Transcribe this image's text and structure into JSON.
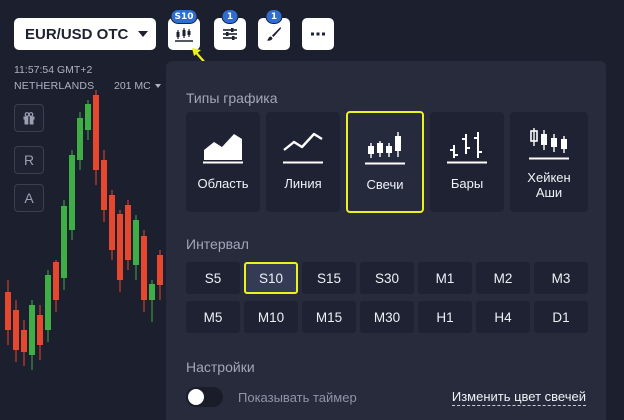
{
  "header": {
    "asset": "EUR/USD OTC",
    "chart_type_badge": "S10",
    "indicators_badge": "1",
    "drawings_badge": "1",
    "more_icon": "ellipsis-icon"
  },
  "meta": {
    "time": "11:57:54 GMT+2",
    "location": "NETHERLANDS",
    "ping": "201 MC"
  },
  "side_tools": {
    "gift_icon": "gift-icon",
    "r_label": "R",
    "a_label": "A"
  },
  "panel": {
    "chart_types_title": "Типы графика",
    "chart_types": [
      {
        "label": "Область",
        "icon": "area-chart-icon"
      },
      {
        "label": "Линия",
        "icon": "line-chart-icon"
      },
      {
        "label": "Свечи",
        "icon": "candles-chart-icon",
        "selected": true
      },
      {
        "label": "Бары",
        "icon": "bars-chart-icon"
      },
      {
        "label": "Хейкен Аши",
        "icon": "heikin-ashi-icon"
      }
    ],
    "interval_title": "Интервал",
    "intervals": [
      "S5",
      "S10",
      "S15",
      "S30",
      "M1",
      "M2",
      "M3",
      "M5",
      "M10",
      "M15",
      "M30",
      "H1",
      "H4",
      "D1"
    ],
    "selected_interval": "S10",
    "settings_title": "Настройки",
    "timer_toggle_label": "Показывать таймер",
    "timer_toggle_on": false,
    "candle_color_link": "Изменить цвет свечей"
  },
  "colors": {
    "accent_highlight": "#eef21c",
    "bull": "#3fae46",
    "bear": "#e6472f",
    "panel_bg": "#272b3c",
    "badge": "#2f6ecf"
  }
}
